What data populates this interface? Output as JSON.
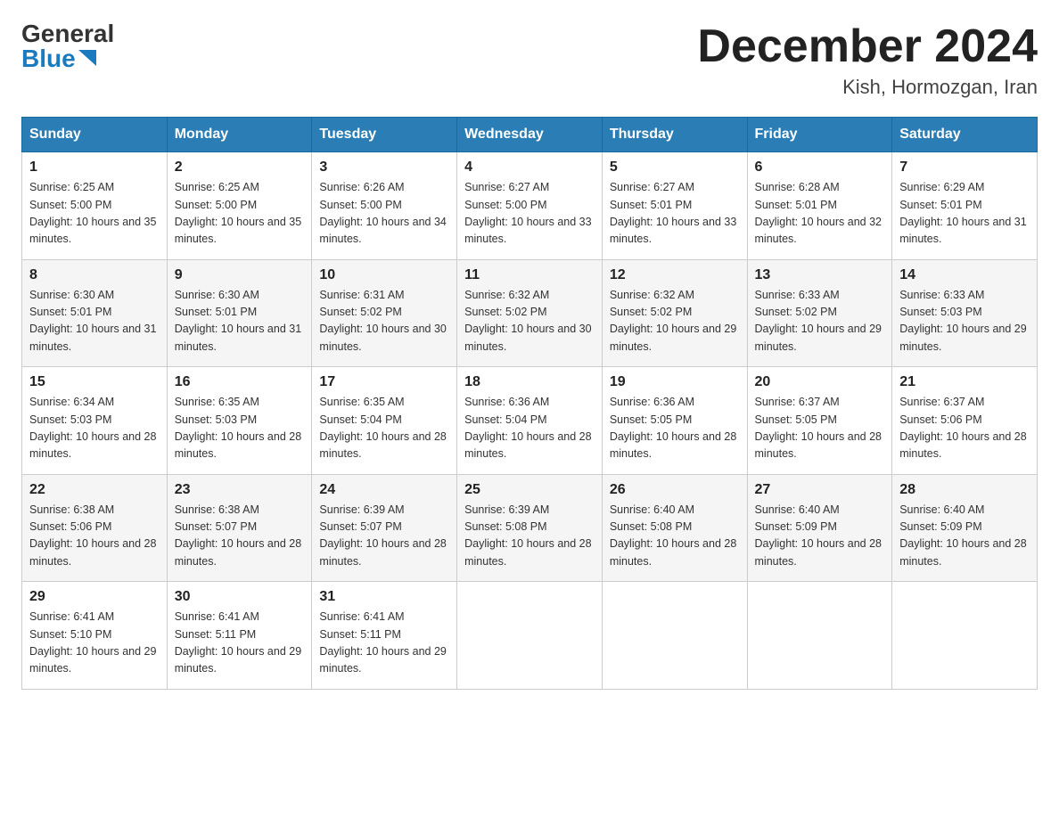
{
  "header": {
    "logo_general": "General",
    "logo_blue": "Blue",
    "month_title": "December 2024",
    "subtitle": "Kish, Hormozgan, Iran"
  },
  "days_of_week": [
    "Sunday",
    "Monday",
    "Tuesday",
    "Wednesday",
    "Thursday",
    "Friday",
    "Saturday"
  ],
  "weeks": [
    [
      {
        "day": "1",
        "sunrise": "6:25 AM",
        "sunset": "5:00 PM",
        "daylight": "10 hours and 35 minutes."
      },
      {
        "day": "2",
        "sunrise": "6:25 AM",
        "sunset": "5:00 PM",
        "daylight": "10 hours and 35 minutes."
      },
      {
        "day": "3",
        "sunrise": "6:26 AM",
        "sunset": "5:00 PM",
        "daylight": "10 hours and 34 minutes."
      },
      {
        "day": "4",
        "sunrise": "6:27 AM",
        "sunset": "5:00 PM",
        "daylight": "10 hours and 33 minutes."
      },
      {
        "day": "5",
        "sunrise": "6:27 AM",
        "sunset": "5:01 PM",
        "daylight": "10 hours and 33 minutes."
      },
      {
        "day": "6",
        "sunrise": "6:28 AM",
        "sunset": "5:01 PM",
        "daylight": "10 hours and 32 minutes."
      },
      {
        "day": "7",
        "sunrise": "6:29 AM",
        "sunset": "5:01 PM",
        "daylight": "10 hours and 31 minutes."
      }
    ],
    [
      {
        "day": "8",
        "sunrise": "6:30 AM",
        "sunset": "5:01 PM",
        "daylight": "10 hours and 31 minutes."
      },
      {
        "day": "9",
        "sunrise": "6:30 AM",
        "sunset": "5:01 PM",
        "daylight": "10 hours and 31 minutes."
      },
      {
        "day": "10",
        "sunrise": "6:31 AM",
        "sunset": "5:02 PM",
        "daylight": "10 hours and 30 minutes."
      },
      {
        "day": "11",
        "sunrise": "6:32 AM",
        "sunset": "5:02 PM",
        "daylight": "10 hours and 30 minutes."
      },
      {
        "day": "12",
        "sunrise": "6:32 AM",
        "sunset": "5:02 PM",
        "daylight": "10 hours and 29 minutes."
      },
      {
        "day": "13",
        "sunrise": "6:33 AM",
        "sunset": "5:02 PM",
        "daylight": "10 hours and 29 minutes."
      },
      {
        "day": "14",
        "sunrise": "6:33 AM",
        "sunset": "5:03 PM",
        "daylight": "10 hours and 29 minutes."
      }
    ],
    [
      {
        "day": "15",
        "sunrise": "6:34 AM",
        "sunset": "5:03 PM",
        "daylight": "10 hours and 28 minutes."
      },
      {
        "day": "16",
        "sunrise": "6:35 AM",
        "sunset": "5:03 PM",
        "daylight": "10 hours and 28 minutes."
      },
      {
        "day": "17",
        "sunrise": "6:35 AM",
        "sunset": "5:04 PM",
        "daylight": "10 hours and 28 minutes."
      },
      {
        "day": "18",
        "sunrise": "6:36 AM",
        "sunset": "5:04 PM",
        "daylight": "10 hours and 28 minutes."
      },
      {
        "day": "19",
        "sunrise": "6:36 AM",
        "sunset": "5:05 PM",
        "daylight": "10 hours and 28 minutes."
      },
      {
        "day": "20",
        "sunrise": "6:37 AM",
        "sunset": "5:05 PM",
        "daylight": "10 hours and 28 minutes."
      },
      {
        "day": "21",
        "sunrise": "6:37 AM",
        "sunset": "5:06 PM",
        "daylight": "10 hours and 28 minutes."
      }
    ],
    [
      {
        "day": "22",
        "sunrise": "6:38 AM",
        "sunset": "5:06 PM",
        "daylight": "10 hours and 28 minutes."
      },
      {
        "day": "23",
        "sunrise": "6:38 AM",
        "sunset": "5:07 PM",
        "daylight": "10 hours and 28 minutes."
      },
      {
        "day": "24",
        "sunrise": "6:39 AM",
        "sunset": "5:07 PM",
        "daylight": "10 hours and 28 minutes."
      },
      {
        "day": "25",
        "sunrise": "6:39 AM",
        "sunset": "5:08 PM",
        "daylight": "10 hours and 28 minutes."
      },
      {
        "day": "26",
        "sunrise": "6:40 AM",
        "sunset": "5:08 PM",
        "daylight": "10 hours and 28 minutes."
      },
      {
        "day": "27",
        "sunrise": "6:40 AM",
        "sunset": "5:09 PM",
        "daylight": "10 hours and 28 minutes."
      },
      {
        "day": "28",
        "sunrise": "6:40 AM",
        "sunset": "5:09 PM",
        "daylight": "10 hours and 28 minutes."
      }
    ],
    [
      {
        "day": "29",
        "sunrise": "6:41 AM",
        "sunset": "5:10 PM",
        "daylight": "10 hours and 29 minutes."
      },
      {
        "day": "30",
        "sunrise": "6:41 AM",
        "sunset": "5:11 PM",
        "daylight": "10 hours and 29 minutes."
      },
      {
        "day": "31",
        "sunrise": "6:41 AM",
        "sunset": "5:11 PM",
        "daylight": "10 hours and 29 minutes."
      },
      null,
      null,
      null,
      null
    ]
  ]
}
